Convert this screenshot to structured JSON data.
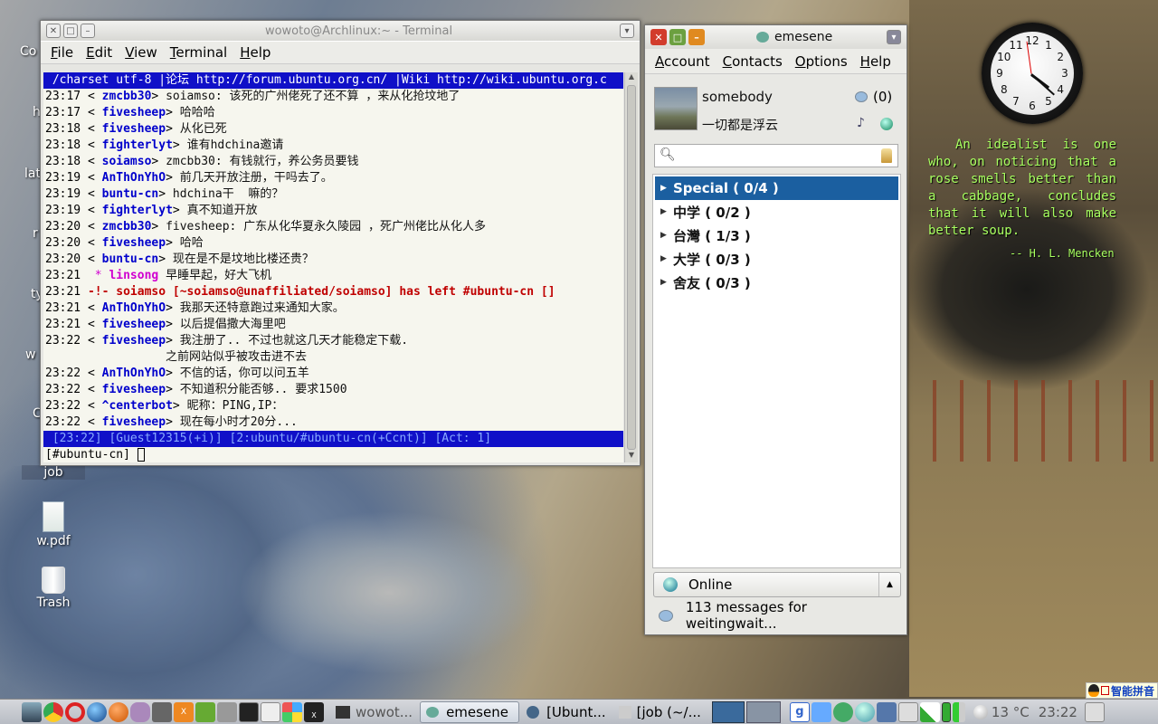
{
  "desktop": {
    "icons": [
      {
        "label": "job"
      },
      {
        "label": "w.pdf"
      },
      {
        "label": "Trash"
      }
    ],
    "partial_labels": [
      "Co",
      "h",
      "lat",
      "r",
      "ty",
      "w",
      "C"
    ],
    "quote": {
      "text": "An idealist is one who, on noticing that a rose smells better than a cabbage, concludes that it will also make better soup.",
      "author": "-- H. L. Mencken"
    }
  },
  "terminal": {
    "title": "wowoto@Archlinux:~ - Terminal",
    "menu": [
      "File",
      "Edit",
      "View",
      "Terminal",
      "Help"
    ],
    "topic": " /charset utf-8 |论坛 http://forum.ubuntu.org.cn/ |Wiki http://wiki.ubuntu.org.c",
    "lines": [
      {
        "ts": "23:17",
        "pre": " < ",
        "nick": "zmcbb30",
        "post": "> ",
        "text": "soiamso: 该死的广州佬死了还不算 ，来从化抢坟地了"
      },
      {
        "ts": "23:17",
        "pre": " < ",
        "nick": "fivesheep",
        "post": "> ",
        "text": "哈哈哈"
      },
      {
        "ts": "23:18",
        "pre": " < ",
        "nick": "fivesheep",
        "post": "> ",
        "text": "从化已死"
      },
      {
        "ts": "23:18",
        "pre": " < ",
        "nick": "fighterlyt",
        "post": "> ",
        "text": "谁有hdchina邀请"
      },
      {
        "ts": "23:18",
        "pre": " < ",
        "nick": "soiamso",
        "post": "> ",
        "text": "zmcbb30: 有钱就行，养公务员要钱"
      },
      {
        "ts": "23:19",
        "pre": " < ",
        "nick": "AnThOnYhO",
        "post": "> ",
        "text": "前几天开放注册，干吗去了。"
      },
      {
        "ts": "23:19",
        "pre": " < ",
        "nick": "buntu-cn",
        "post": "> ",
        "text": "hdchina干  嘛的？"
      },
      {
        "ts": "23:19",
        "pre": " < ",
        "nick": "fighterlyt",
        "post": "> ",
        "text": "真不知道开放"
      },
      {
        "ts": "23:20",
        "pre": " < ",
        "nick": "zmcbb30",
        "post": "> ",
        "text": "fivesheep: 广东从化华夏永久陵园 ，死广州佬比从化人多"
      },
      {
        "ts": "23:20",
        "pre": " < ",
        "nick": "fivesheep",
        "post": "> ",
        "text": "哈哈"
      },
      {
        "ts": "23:20",
        "pre": " < ",
        "nick": "buntu-cn",
        "post": "> ",
        "text": "现在是不是坟地比楼还贵？"
      },
      {
        "ts": "23:21",
        "pre": "  * ",
        "nick": "linsong",
        "post": " ",
        "text": "早睡早起，好大飞机",
        "action": true
      },
      {
        "ts": "23:21",
        "quit": " -!- soiamso [~soiamso@unaffiliated/soiamso] has left #ubuntu-cn []"
      },
      {
        "ts": "23:21",
        "pre": " < ",
        "nick": "AnThOnYhO",
        "post": "> ",
        "text": "我那天还特意跑过来通知大家。"
      },
      {
        "ts": "23:21",
        "pre": " < ",
        "nick": "fivesheep",
        "post": "> ",
        "text": "以后提倡撒大海里吧"
      },
      {
        "ts": "23:22",
        "pre": " < ",
        "nick": "fivesheep",
        "post": "> ",
        "text": "我注册了.. 不过也就这几天才能稳定下载."
      },
      {
        "ts": "",
        "cont": "                 之前网站似乎被攻击进不去"
      },
      {
        "ts": "23:22",
        "pre": " < ",
        "nick": "AnThOnYhO",
        "post": "> ",
        "text": "不信的话，你可以问五羊"
      },
      {
        "ts": "23:22",
        "pre": " < ",
        "nick": "fivesheep",
        "post": "> ",
        "text": "不知道积分能否够.. 要求1500"
      },
      {
        "ts": "23:22",
        "pre": " < ",
        "nick": "^centerbot",
        "post": "> ",
        "text": "昵称：PING,IP："
      },
      {
        "ts": "23:22",
        "pre": " < ",
        "nick": "fivesheep",
        "post": "> ",
        "text": "现在每小时才20分..."
      }
    ],
    "status": " [23:22] [Guest12315(+i)] [2:ubuntu/#ubuntu-cn(+Ccnt)] [Act: 1]",
    "prompt": "[#ubuntu-cn] "
  },
  "emesene": {
    "title": "emesene",
    "menu": [
      "Account",
      "Contacts",
      "Options",
      "Help"
    ],
    "nick": "somebody",
    "message": "一切都是浮云",
    "mail_count": "(0)",
    "search_placeholder": "",
    "groups": [
      {
        "label": "Special ( 0/4 )",
        "selected": true
      },
      {
        "label": "中学 ( 0/2 )"
      },
      {
        "label": "台灣 ( 1/3 )"
      },
      {
        "label": "大学 ( 0/3 )"
      },
      {
        "label": "舍友 ( 0/3 )"
      }
    ],
    "status": "Online",
    "mail_notice": "113 messages for weitingwait..."
  },
  "clock": {
    "numbers": [
      "12",
      "1",
      "2",
      "3",
      "4",
      "5",
      "6",
      "7",
      "8",
      "9",
      "10",
      "11"
    ]
  },
  "taskbar": {
    "tasks": [
      "wowot...",
      "emesene",
      "[Ubunt...",
      "[job (~/..."
    ],
    "weather": "13 °C",
    "time": "23:22",
    "ime": "智能拼音"
  },
  "colors": {
    "accent": "#1b5fa0",
    "terminal_bar": "#1010c8",
    "nick": "#0000cc",
    "quote": "#a8ff60"
  }
}
